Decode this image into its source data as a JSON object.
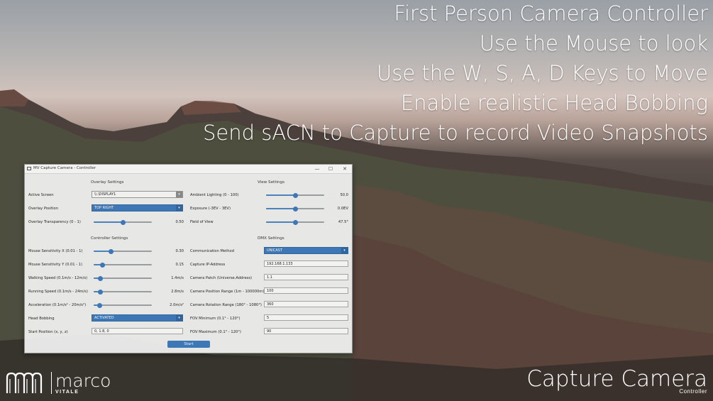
{
  "headlines": [
    "First Person Camera Controller",
    "Use the Mouse to look",
    "Use the W, S, A, D Keys to Move",
    "Enable realistic Head Bobbing",
    "Send sACN to Capture to record Video Snapshots"
  ],
  "window": {
    "title": "MV Capture Camera - Controller",
    "controls": {
      "minimize": "—",
      "maximize": "☐",
      "close": "✕"
    }
  },
  "overlay_settings": {
    "heading": "Overlay Settings",
    "active_screen": {
      "label": "Active Screen",
      "value": "\\\\.\\DISPLAY1"
    },
    "overlay_position": {
      "label": "Overlay Position",
      "value": "TOP RIGHT"
    },
    "overlay_transparency": {
      "label": "Overlay Transparency (0 - 1)",
      "value": "0.50",
      "level": 0.5
    }
  },
  "controller_settings": {
    "heading": "Controller Settings",
    "sliders": [
      {
        "label": "Mouse Sensitivity X (0.01 - 1)",
        "value": "0.30",
        "level": 0.3
      },
      {
        "label": "Mouse Sensitivity Y (0.01 - 1)",
        "value": "0.15",
        "level": 0.15
      },
      {
        "label": "Walking Speed (0.1m/s - 12m/s)",
        "value": "1.4m/s",
        "level": 0.11
      },
      {
        "label": "Running Speed (0.1m/s - 24m/s)",
        "value": "2.8m/s",
        "level": 0.11
      },
      {
        "label": "Acceleration (0.1m/s² - 20m/s²)",
        "value": "2.0m/s²",
        "level": 0.1
      }
    ],
    "head_bobbing": {
      "label": "Head Bobbing",
      "value": "ACTIVATED"
    },
    "start_position": {
      "label": "Start Position (x, y, z)",
      "value": "0, 1.8, 0"
    }
  },
  "view_settings": {
    "heading": "View Settings",
    "sliders": [
      {
        "label": "Ambient Lighting (0 - 100)",
        "value": "50.0",
        "level": 0.5
      },
      {
        "label": "Exposure (-3EV - 3EV)",
        "value": "0.0EV",
        "level": 0.5
      },
      {
        "label": "Field of View",
        "value": "47.5°",
        "level": 0.5
      }
    ]
  },
  "dmx_settings": {
    "heading": "DMX Settings",
    "communication_method": {
      "label": "Communication Method",
      "value": "UNICAST"
    },
    "fields": [
      {
        "label": "Capture IP-Address",
        "value": "192.168.1.133"
      },
      {
        "label": "Camera Patch (Universe.Address)",
        "value": "1.1"
      },
      {
        "label": "Camera Position Range (1m - 100000m)",
        "value": "100"
      },
      {
        "label": "Camera Rotation Range (180° - 1080°)",
        "value": "360"
      },
      {
        "label": "FOV Minimum (0.1° - 120°)",
        "value": "5"
      },
      {
        "label": "FOV Maximum (0.1° - 120°)",
        "value": "90"
      }
    ]
  },
  "start_button": "Start",
  "logo": {
    "name": "marco",
    "sub": "VITALE"
  },
  "brand": {
    "title": "Capture Camera",
    "subtitle": "Controller"
  },
  "colors": {
    "accent": "#3c7bc0",
    "window_bg": "#f3f3f3"
  }
}
